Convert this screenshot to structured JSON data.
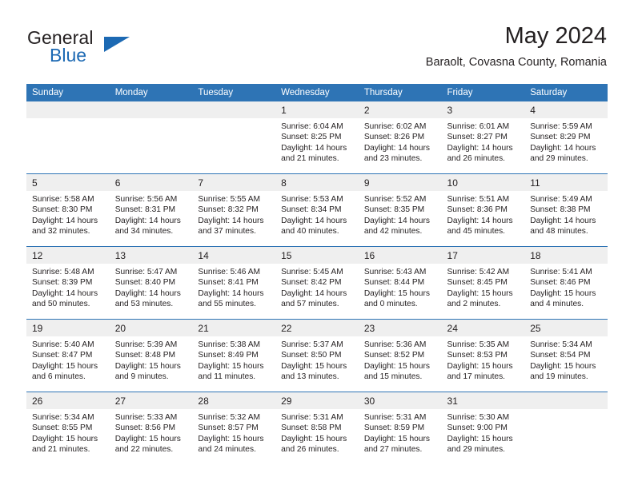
{
  "brand": {
    "word1": "General",
    "word2": "Blue",
    "logo_icon": "triangle-logo",
    "accent_color": "#1c69b3"
  },
  "header": {
    "title": "May 2024",
    "subtitle": "Baraolt, Covasna County, Romania"
  },
  "calendar": {
    "header_color": "#2e74b5",
    "daynum_band_color": "#efefef",
    "weekday_headers": [
      "Sunday",
      "Monday",
      "Tuesday",
      "Wednesday",
      "Thursday",
      "Friday",
      "Saturday"
    ],
    "weeks": [
      [
        {
          "day": "",
          "sunrise": "",
          "sunset": "",
          "daylight1": "",
          "daylight2": ""
        },
        {
          "day": "",
          "sunrise": "",
          "sunset": "",
          "daylight1": "",
          "daylight2": ""
        },
        {
          "day": "",
          "sunrise": "",
          "sunset": "",
          "daylight1": "",
          "daylight2": ""
        },
        {
          "day": "1",
          "sunrise": "Sunrise: 6:04 AM",
          "sunset": "Sunset: 8:25 PM",
          "daylight1": "Daylight: 14 hours",
          "daylight2": "and 21 minutes."
        },
        {
          "day": "2",
          "sunrise": "Sunrise: 6:02 AM",
          "sunset": "Sunset: 8:26 PM",
          "daylight1": "Daylight: 14 hours",
          "daylight2": "and 23 minutes."
        },
        {
          "day": "3",
          "sunrise": "Sunrise: 6:01 AM",
          "sunset": "Sunset: 8:27 PM",
          "daylight1": "Daylight: 14 hours",
          "daylight2": "and 26 minutes."
        },
        {
          "day": "4",
          "sunrise": "Sunrise: 5:59 AM",
          "sunset": "Sunset: 8:29 PM",
          "daylight1": "Daylight: 14 hours",
          "daylight2": "and 29 minutes."
        }
      ],
      [
        {
          "day": "5",
          "sunrise": "Sunrise: 5:58 AM",
          "sunset": "Sunset: 8:30 PM",
          "daylight1": "Daylight: 14 hours",
          "daylight2": "and 32 minutes."
        },
        {
          "day": "6",
          "sunrise": "Sunrise: 5:56 AM",
          "sunset": "Sunset: 8:31 PM",
          "daylight1": "Daylight: 14 hours",
          "daylight2": "and 34 minutes."
        },
        {
          "day": "7",
          "sunrise": "Sunrise: 5:55 AM",
          "sunset": "Sunset: 8:32 PM",
          "daylight1": "Daylight: 14 hours",
          "daylight2": "and 37 minutes."
        },
        {
          "day": "8",
          "sunrise": "Sunrise: 5:53 AM",
          "sunset": "Sunset: 8:34 PM",
          "daylight1": "Daylight: 14 hours",
          "daylight2": "and 40 minutes."
        },
        {
          "day": "9",
          "sunrise": "Sunrise: 5:52 AM",
          "sunset": "Sunset: 8:35 PM",
          "daylight1": "Daylight: 14 hours",
          "daylight2": "and 42 minutes."
        },
        {
          "day": "10",
          "sunrise": "Sunrise: 5:51 AM",
          "sunset": "Sunset: 8:36 PM",
          "daylight1": "Daylight: 14 hours",
          "daylight2": "and 45 minutes."
        },
        {
          "day": "11",
          "sunrise": "Sunrise: 5:49 AM",
          "sunset": "Sunset: 8:38 PM",
          "daylight1": "Daylight: 14 hours",
          "daylight2": "and 48 minutes."
        }
      ],
      [
        {
          "day": "12",
          "sunrise": "Sunrise: 5:48 AM",
          "sunset": "Sunset: 8:39 PM",
          "daylight1": "Daylight: 14 hours",
          "daylight2": "and 50 minutes."
        },
        {
          "day": "13",
          "sunrise": "Sunrise: 5:47 AM",
          "sunset": "Sunset: 8:40 PM",
          "daylight1": "Daylight: 14 hours",
          "daylight2": "and 53 minutes."
        },
        {
          "day": "14",
          "sunrise": "Sunrise: 5:46 AM",
          "sunset": "Sunset: 8:41 PM",
          "daylight1": "Daylight: 14 hours",
          "daylight2": "and 55 minutes."
        },
        {
          "day": "15",
          "sunrise": "Sunrise: 5:45 AM",
          "sunset": "Sunset: 8:42 PM",
          "daylight1": "Daylight: 14 hours",
          "daylight2": "and 57 minutes."
        },
        {
          "day": "16",
          "sunrise": "Sunrise: 5:43 AM",
          "sunset": "Sunset: 8:44 PM",
          "daylight1": "Daylight: 15 hours",
          "daylight2": "and 0 minutes."
        },
        {
          "day": "17",
          "sunrise": "Sunrise: 5:42 AM",
          "sunset": "Sunset: 8:45 PM",
          "daylight1": "Daylight: 15 hours",
          "daylight2": "and 2 minutes."
        },
        {
          "day": "18",
          "sunrise": "Sunrise: 5:41 AM",
          "sunset": "Sunset: 8:46 PM",
          "daylight1": "Daylight: 15 hours",
          "daylight2": "and 4 minutes."
        }
      ],
      [
        {
          "day": "19",
          "sunrise": "Sunrise: 5:40 AM",
          "sunset": "Sunset: 8:47 PM",
          "daylight1": "Daylight: 15 hours",
          "daylight2": "and 6 minutes."
        },
        {
          "day": "20",
          "sunrise": "Sunrise: 5:39 AM",
          "sunset": "Sunset: 8:48 PM",
          "daylight1": "Daylight: 15 hours",
          "daylight2": "and 9 minutes."
        },
        {
          "day": "21",
          "sunrise": "Sunrise: 5:38 AM",
          "sunset": "Sunset: 8:49 PM",
          "daylight1": "Daylight: 15 hours",
          "daylight2": "and 11 minutes."
        },
        {
          "day": "22",
          "sunrise": "Sunrise: 5:37 AM",
          "sunset": "Sunset: 8:50 PM",
          "daylight1": "Daylight: 15 hours",
          "daylight2": "and 13 minutes."
        },
        {
          "day": "23",
          "sunrise": "Sunrise: 5:36 AM",
          "sunset": "Sunset: 8:52 PM",
          "daylight1": "Daylight: 15 hours",
          "daylight2": "and 15 minutes."
        },
        {
          "day": "24",
          "sunrise": "Sunrise: 5:35 AM",
          "sunset": "Sunset: 8:53 PM",
          "daylight1": "Daylight: 15 hours",
          "daylight2": "and 17 minutes."
        },
        {
          "day": "25",
          "sunrise": "Sunrise: 5:34 AM",
          "sunset": "Sunset: 8:54 PM",
          "daylight1": "Daylight: 15 hours",
          "daylight2": "and 19 minutes."
        }
      ],
      [
        {
          "day": "26",
          "sunrise": "Sunrise: 5:34 AM",
          "sunset": "Sunset: 8:55 PM",
          "daylight1": "Daylight: 15 hours",
          "daylight2": "and 21 minutes."
        },
        {
          "day": "27",
          "sunrise": "Sunrise: 5:33 AM",
          "sunset": "Sunset: 8:56 PM",
          "daylight1": "Daylight: 15 hours",
          "daylight2": "and 22 minutes."
        },
        {
          "day": "28",
          "sunrise": "Sunrise: 5:32 AM",
          "sunset": "Sunset: 8:57 PM",
          "daylight1": "Daylight: 15 hours",
          "daylight2": "and 24 minutes."
        },
        {
          "day": "29",
          "sunrise": "Sunrise: 5:31 AM",
          "sunset": "Sunset: 8:58 PM",
          "daylight1": "Daylight: 15 hours",
          "daylight2": "and 26 minutes."
        },
        {
          "day": "30",
          "sunrise": "Sunrise: 5:31 AM",
          "sunset": "Sunset: 8:59 PM",
          "daylight1": "Daylight: 15 hours",
          "daylight2": "and 27 minutes."
        },
        {
          "day": "31",
          "sunrise": "Sunrise: 5:30 AM",
          "sunset": "Sunset: 9:00 PM",
          "daylight1": "Daylight: 15 hours",
          "daylight2": "and 29 minutes."
        },
        {
          "day": "",
          "sunrise": "",
          "sunset": "",
          "daylight1": "",
          "daylight2": ""
        }
      ]
    ]
  }
}
